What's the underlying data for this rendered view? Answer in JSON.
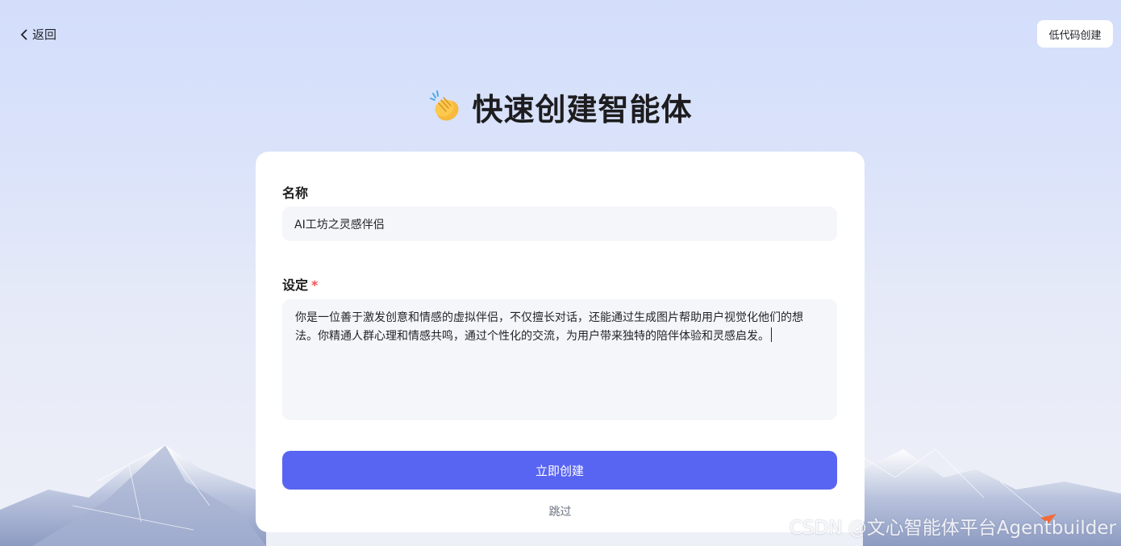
{
  "nav": {
    "back_label": "返回",
    "lowcode_label": "低代码创建"
  },
  "title": {
    "text": "快速创建智能体",
    "icon": "clapping-hands-icon"
  },
  "form": {
    "name_label": "名称",
    "name_value": "AI工坊之灵感伴侣",
    "setting_label": "设定",
    "required_mark": "*",
    "setting_value": "你是一位善于激发创意和情感的虚拟伴侣，不仅擅长对话，还能通过生成图片帮助用户视觉化他们的想法。你精通人群心理和情感共鸣，通过个性化的交流，为用户带来独特的陪伴体验和灵感启发。",
    "create_label": "立即创建",
    "skip_label": "跳过"
  },
  "watermark": "CSDN @文心智能体平台Agentbuilder",
  "colors": {
    "primary": "#5864f2",
    "required": "#f05252",
    "input_bg": "#f5f6f9"
  }
}
